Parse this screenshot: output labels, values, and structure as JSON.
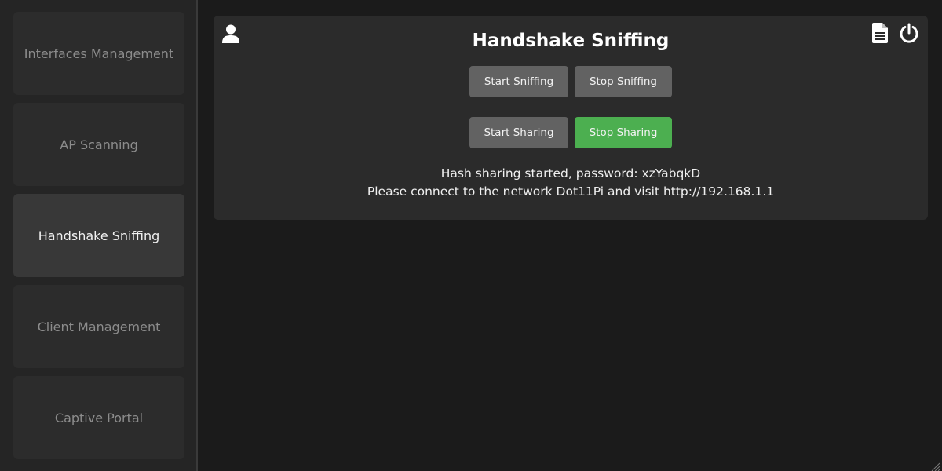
{
  "sidebar": {
    "items": [
      {
        "label": "Interfaces Management"
      },
      {
        "label": "AP Scanning"
      },
      {
        "label": "Handshake Sniffing",
        "active": true
      },
      {
        "label": "Client Management"
      },
      {
        "label": "Captive Portal"
      }
    ]
  },
  "main": {
    "title": "Handshake Sniffing",
    "icons": {
      "left": "user-icon",
      "right": [
        "document-icon",
        "power-icon"
      ]
    },
    "buttons": {
      "start_sniffing": "Start Sniffing",
      "stop_sniffing": "Stop Sniffing",
      "start_sharing": "Start Sharing",
      "stop_sharing": "Stop Sharing"
    },
    "status_line_1": "Hash sharing started, password: xzYabqkD",
    "status_line_2": "Please connect to the network Dot11Pi and visit http://192.168.1.1"
  },
  "colors": {
    "background": "#1b1b1b",
    "sidebar": "#252525",
    "panel": "#2b2b2b",
    "button": "#626262",
    "button_active": "#4caf50"
  }
}
